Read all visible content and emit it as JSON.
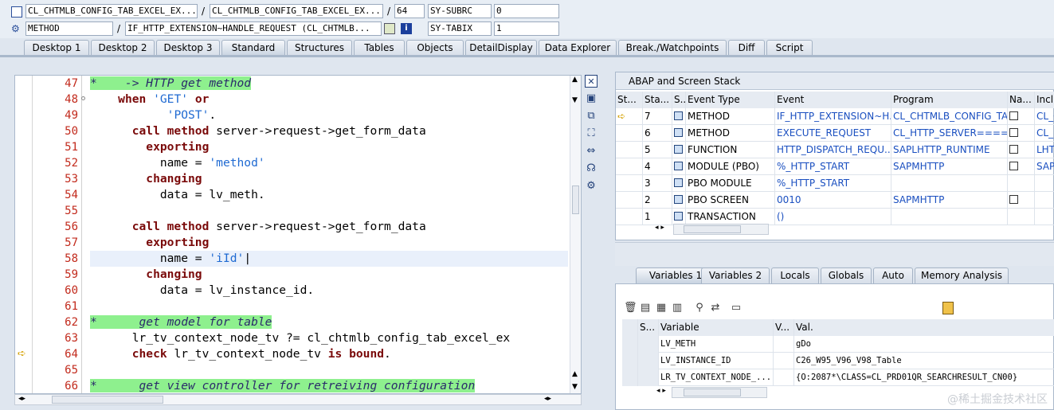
{
  "header": {
    "row1": {
      "prog1": "CL_CHTMLB_CONFIG_TAB_EXCEL_EX...",
      "prog2": "CL_CHTMLB_CONFIG_TAB_EXCEL_EX...",
      "line": "64",
      "sysvar": "SY-SUBRC",
      "sysval": "0"
    },
    "row2": {
      "evtype": "METHOD",
      "event": "IF_HTTP_EXTENSION~HANDLE_REQUEST (CL_CHTMLB...",
      "sysvar": "SY-TABIX",
      "sysval": "1"
    },
    "sep": "/"
  },
  "tabs": [
    {
      "label": "Desktop 1"
    },
    {
      "label": "Desktop 2"
    },
    {
      "label": "Desktop 3"
    },
    {
      "label": "Standard",
      "active": true
    },
    {
      "label": "Structures"
    },
    {
      "label": "Tables"
    },
    {
      "label": "Objects"
    },
    {
      "label": "DetailDisplay"
    },
    {
      "label": "Data Explorer"
    },
    {
      "label": "Break./Watchpoints"
    },
    {
      "label": "Diff"
    },
    {
      "label": "Script"
    }
  ],
  "editor": {
    "lines": [
      {
        "n": "47",
        "segs": [
          [
            "cmt",
            "*    -> HTTP get method"
          ]
        ]
      },
      {
        "n": "48",
        "segs": [
          [
            "",
            "    "
          ],
          [
            "kw",
            "when"
          ],
          [
            "",
            " "
          ],
          [
            "str",
            "'GET'"
          ],
          [
            "",
            " "
          ],
          [
            "kw",
            "or"
          ]
        ]
      },
      {
        "n": "49",
        "segs": [
          [
            "",
            "           "
          ],
          [
            "str",
            "'POST'"
          ],
          [
            "",
            "."
          ]
        ]
      },
      {
        "n": "50",
        "segs": [
          [
            "",
            "      "
          ],
          [
            "kw",
            "call method"
          ],
          [
            "",
            " server->request->get_form_data"
          ]
        ]
      },
      {
        "n": "51",
        "segs": [
          [
            "",
            "        "
          ],
          [
            "kw",
            "exporting"
          ]
        ]
      },
      {
        "n": "52",
        "segs": [
          [
            "",
            "          name = "
          ],
          [
            "str",
            "'method'"
          ]
        ]
      },
      {
        "n": "53",
        "segs": [
          [
            "",
            "        "
          ],
          [
            "kw",
            "changing"
          ]
        ]
      },
      {
        "n": "54",
        "segs": [
          [
            "",
            "          data = lv_meth."
          ]
        ]
      },
      {
        "n": "55",
        "segs": []
      },
      {
        "n": "56",
        "segs": [
          [
            "",
            "      "
          ],
          [
            "kw",
            "call method"
          ],
          [
            "",
            " server->request->get_form_data"
          ]
        ]
      },
      {
        "n": "57",
        "segs": [
          [
            "",
            "        "
          ],
          [
            "kw",
            "exporting"
          ]
        ]
      },
      {
        "n": "58",
        "segs": [
          [
            "",
            "          name = "
          ],
          [
            "str",
            "'iId'"
          ],
          [
            "",
            "|"
          ]
        ],
        "current": true
      },
      {
        "n": "59",
        "segs": [
          [
            "",
            "        "
          ],
          [
            "kw",
            "changing"
          ]
        ]
      },
      {
        "n": "60",
        "segs": [
          [
            "",
            "          data = lv_instance_id."
          ]
        ]
      },
      {
        "n": "61",
        "segs": []
      },
      {
        "n": "62",
        "segs": [
          [
            "cmt",
            "*      get model for table"
          ]
        ]
      },
      {
        "n": "63",
        "segs": [
          [
            "",
            "      lr_tv_context_node_tv ?= cl_chtmlb_config_tab_excel_ex"
          ]
        ]
      },
      {
        "n": "64",
        "segs": [
          [
            "",
            "      "
          ],
          [
            "kw",
            "check"
          ],
          [
            "",
            " lr_tv_context_node_tv "
          ],
          [
            "kw",
            "is bound"
          ],
          [
            "",
            "."
          ]
        ],
        "arrow": true
      },
      {
        "n": "65",
        "segs": []
      },
      {
        "n": "66",
        "segs": [
          [
            "cmt",
            "*      get view controller for retreiving configuration"
          ]
        ]
      }
    ]
  },
  "stack": {
    "title": "ABAP and Screen Stack",
    "columns": [
      "St...",
      "Sta...",
      "S...",
      "Event Type",
      "Event",
      "Program",
      "Na...",
      "Inclu"
    ],
    "rows": [
      {
        "arrow": true,
        "level": "7",
        "type": "METHOD",
        "event": "IF_HTTP_EXTENSION~H...",
        "program": "CL_CHTMLB_CONFIG_TA...",
        "incl": "CL_C"
      },
      {
        "arrow": false,
        "level": "6",
        "type": "METHOD",
        "event": "EXECUTE_REQUEST",
        "program": "CL_HTTP_SERVER====...",
        "incl": "CL_H"
      },
      {
        "arrow": false,
        "level": "5",
        "type": "FUNCTION",
        "event": "HTTP_DISPATCH_REQU...",
        "program": "SAPLHTTP_RUNTIME",
        "incl": "LHTT"
      },
      {
        "arrow": false,
        "level": "4",
        "type": "MODULE (PBO)",
        "event": "%_HTTP_START",
        "program": "SAPMHTTP",
        "incl": "SAPM"
      },
      {
        "arrow": false,
        "level": "3",
        "type": "PBO MODULE",
        "event": "%_HTTP_START",
        "program": "",
        "incl": ""
      },
      {
        "arrow": false,
        "level": "2",
        "type": "PBO SCREEN",
        "event": "0010",
        "program": "SAPMHTTP",
        "incl": ""
      },
      {
        "arrow": false,
        "level": "1",
        "type": "TRANSACTION",
        "event": "()",
        "program": "",
        "incl": ""
      }
    ]
  },
  "vartabs": [
    {
      "label": "Variables 1",
      "active": true
    },
    {
      "label": "Variables 2"
    },
    {
      "label": "Locals"
    },
    {
      "label": "Globals"
    },
    {
      "label": "Auto"
    },
    {
      "label": "Memory Analysis"
    }
  ],
  "vars": {
    "columns": [
      "S...",
      "Variable",
      "V...",
      "Val."
    ],
    "rows": [
      {
        "name": "LV_METH",
        "value": "gDo"
      },
      {
        "name": "LV_INSTANCE_ID",
        "value": "C26_W95_V96_V98_Table"
      },
      {
        "name": "LR_TV_CONTEXT_NODE_...",
        "value": "{O:2087*\\CLASS=CL_PRD01QR_SEARCHRESULT_CN00}"
      }
    ]
  },
  "watermark": "@稀土掘金技术社区",
  "colors": {
    "comment_bg": "#8ef08e",
    "keyword": "#7a0a0a",
    "string": "#1f6ad2",
    "linenum": "#c22a1c"
  }
}
